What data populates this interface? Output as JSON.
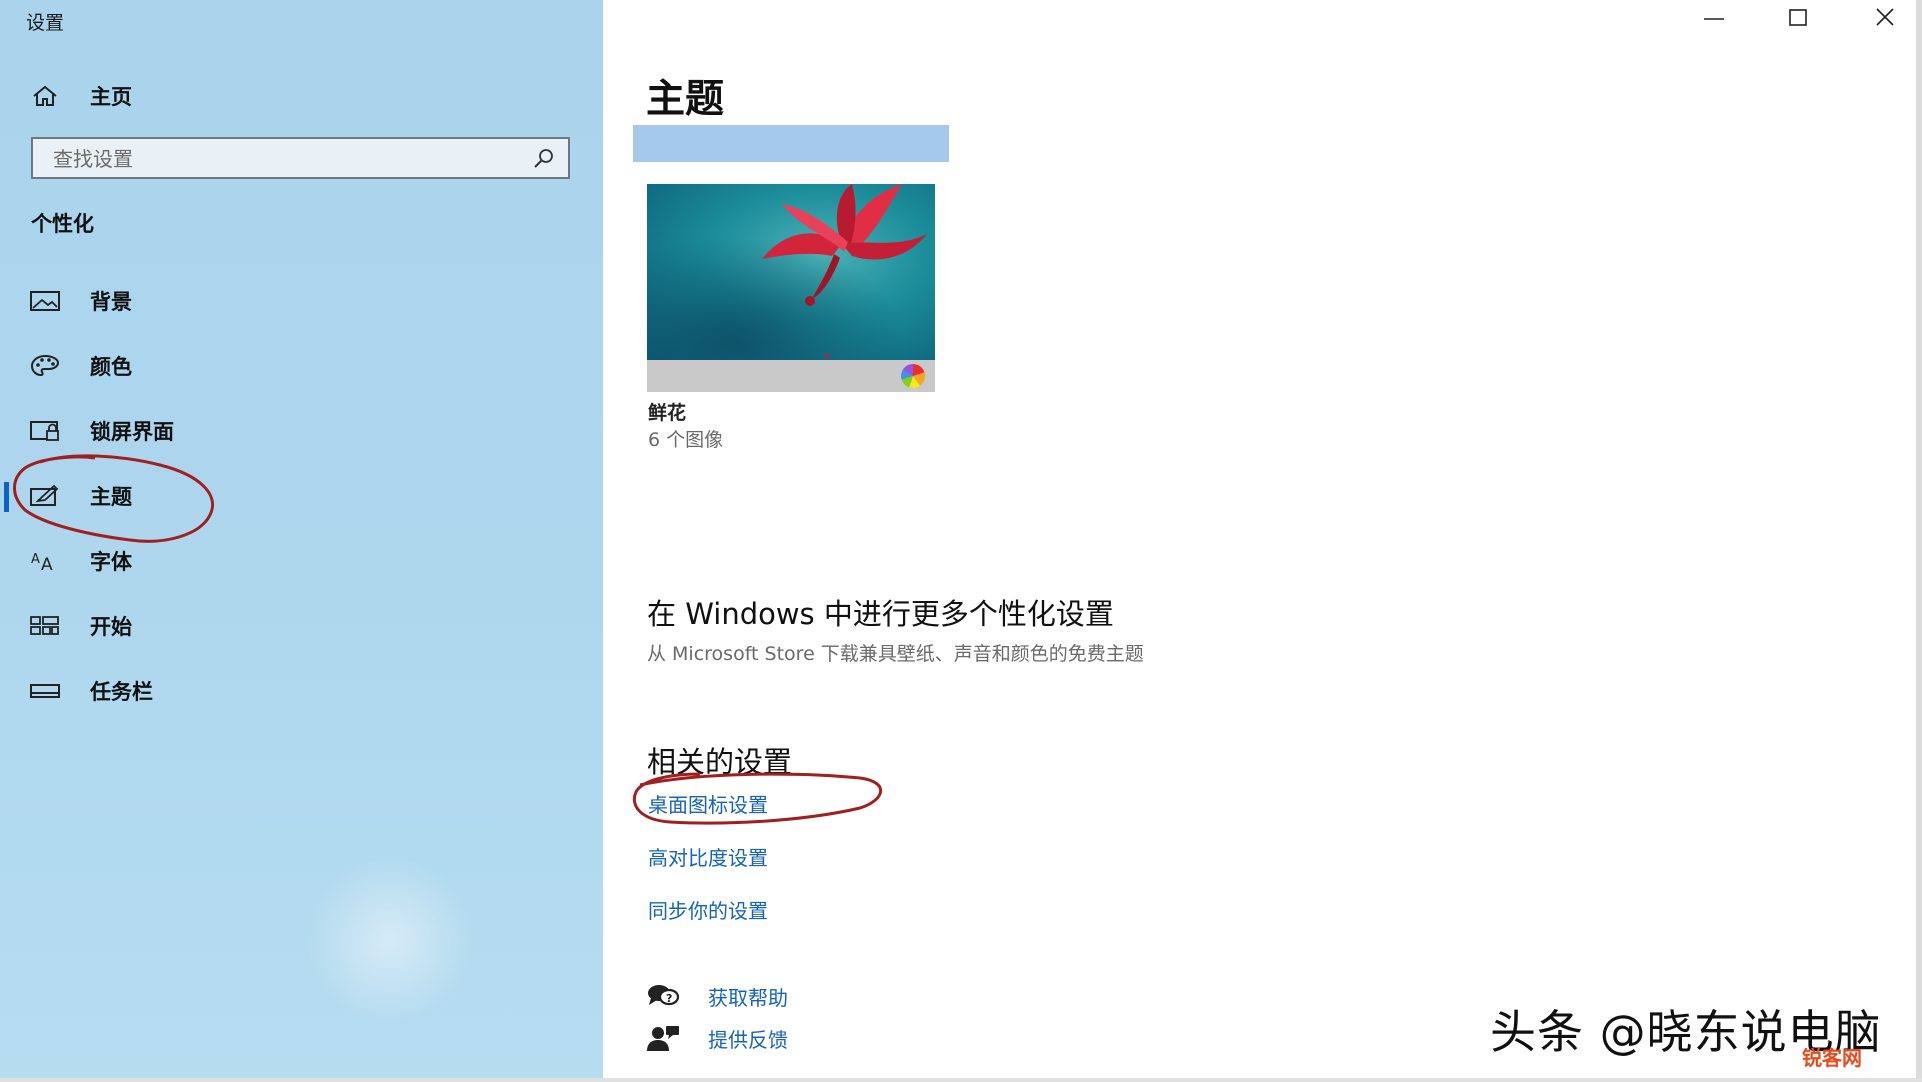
{
  "window": {
    "title": "设置",
    "controls": {
      "minimize": "minimize-icon",
      "maximize": "maximize-icon",
      "close": "close-icon"
    }
  },
  "sidebar": {
    "home": {
      "label": "主页",
      "icon": "home-icon"
    },
    "search": {
      "placeholder": "查找设置",
      "icon": "search-icon"
    },
    "section": "个性化",
    "items": [
      {
        "label": "背景",
        "icon": "picture-icon"
      },
      {
        "label": "颜色",
        "icon": "palette-icon"
      },
      {
        "label": "锁屏界面",
        "icon": "lock-screen-icon"
      },
      {
        "label": "主题",
        "icon": "theme-icon",
        "active": true
      },
      {
        "label": "字体",
        "icon": "font-icon"
      },
      {
        "label": "开始",
        "icon": "start-icon"
      },
      {
        "label": "任务栏",
        "icon": "taskbar-icon"
      }
    ],
    "active_color": "#0a64c6"
  },
  "main": {
    "title": "主题",
    "accent_color": "#a4c9ec",
    "theme": {
      "name": "鲜花",
      "count": "6 个图像"
    },
    "more": {
      "heading": "在 Windows 中进行更多个性化设置",
      "subtitle": "从 Microsoft Store 下载兼具壁纸、声音和颜色的免费主题"
    },
    "related": {
      "heading": "相关的设置",
      "links": [
        "桌面图标设置",
        "高对比度设置",
        "同步你的设置"
      ]
    },
    "help": [
      {
        "label": "获取帮助",
        "icon": "help-chat-icon"
      },
      {
        "label": "提供反馈",
        "icon": "feedback-icon"
      }
    ]
  },
  "watermark": {
    "text": "头条 @晓东说电脑",
    "site": "锐客网"
  },
  "link_color": "#1663b8",
  "annotation_color": "#a01f1f"
}
